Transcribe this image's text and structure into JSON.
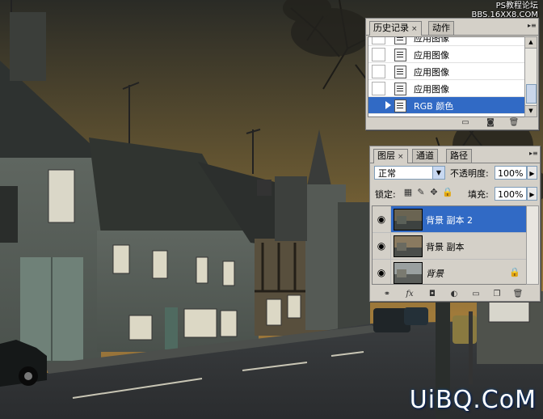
{
  "watermark": {
    "line1": "PS教程论坛",
    "line2": "BBS.16XX8.COM",
    "brand": "UiBQ.CoM"
  },
  "history_panel": {
    "tabs": [
      {
        "label": "历史记录",
        "close": "×",
        "active": true
      },
      {
        "label": "动作",
        "active": false
      }
    ],
    "menu_icon": "panel-menu-icon",
    "items": [
      {
        "label": "应用图像",
        "selected": false
      },
      {
        "label": "应用图像",
        "selected": false
      },
      {
        "label": "应用图像",
        "selected": false
      },
      {
        "label": "应用图像",
        "selected": false
      },
      {
        "label": "RGB 颜色",
        "selected": true
      }
    ],
    "footer_icons": [
      "new-document-from-state-icon",
      "camera-snapshot-icon",
      "trash-icon"
    ]
  },
  "layers_panel": {
    "tabs": [
      {
        "label": "图层",
        "close": "×",
        "active": true
      },
      {
        "label": "通道",
        "active": false
      },
      {
        "label": "路径",
        "active": false
      }
    ],
    "blend_mode": "正常",
    "opacity_label": "不透明度:",
    "opacity_value": "100%",
    "lock_label": "锁定:",
    "fill_label": "填充:",
    "fill_value": "100%",
    "layers": [
      {
        "name": "背景 副本 2",
        "selected": true,
        "visible": true,
        "locked": false
      },
      {
        "name": "背景 副本",
        "selected": false,
        "visible": true,
        "locked": false
      },
      {
        "name": "背景",
        "selected": false,
        "visible": true,
        "locked": true,
        "italic": true
      }
    ],
    "footer_icons": [
      "link-layers-icon",
      "fx-icon",
      "mask-icon",
      "adjustment-layer-icon",
      "new-group-icon",
      "new-layer-icon",
      "trash-icon"
    ],
    "fx_label": "fx"
  }
}
